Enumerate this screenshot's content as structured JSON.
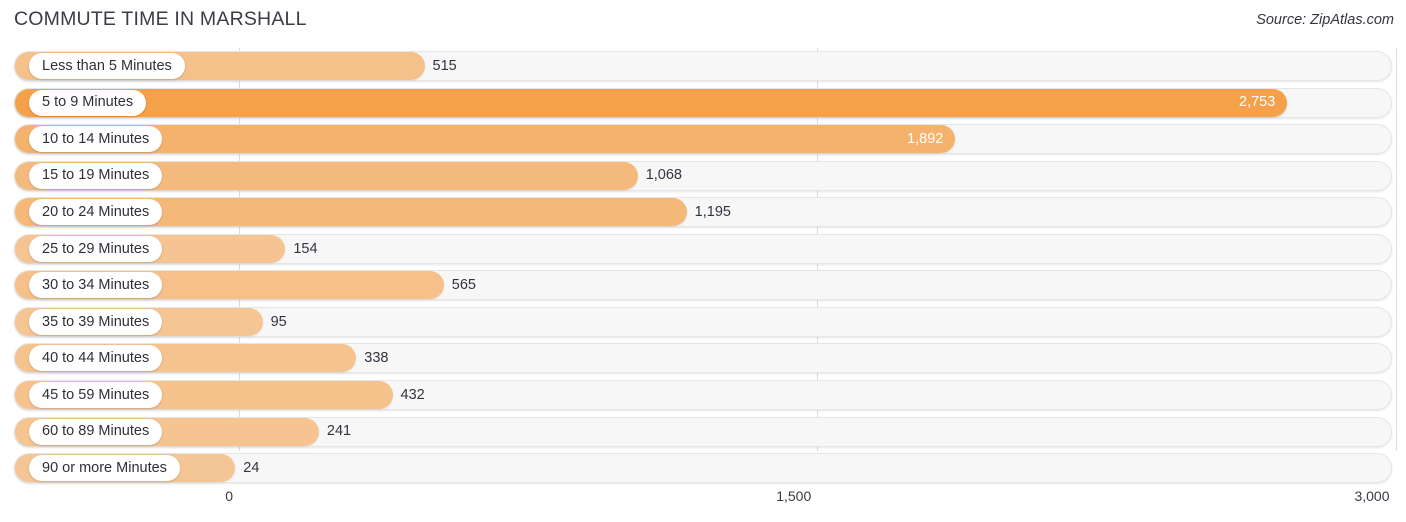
{
  "header": {
    "title": "COMMUTE TIME IN MARSHALL",
    "source": "Source: ZipAtlas.com"
  },
  "colors": {
    "bar": "#f4a14a",
    "track": "#f7f7f7",
    "track_border": "#e6e6e6",
    "gridline": "#dcdcdc",
    "label_text": "#2f2f39",
    "value_text_outside": "#333340",
    "value_text_inside": "#ffffff",
    "title_text": "#3c3c46"
  },
  "chart_data": {
    "type": "bar",
    "orientation": "horizontal",
    "title": "COMMUTE TIME IN MARSHALL",
    "xlabel": "",
    "ylabel": "",
    "xlim": [
      0,
      3000
    ],
    "grid": true,
    "legend": "none",
    "axis_ticks": [
      "0",
      "1,500",
      "3,000"
    ],
    "axis_tick_values": [
      0,
      1500,
      3000
    ],
    "categories": [
      "Less than 5 Minutes",
      "5 to 9 Minutes",
      "10 to 14 Minutes",
      "15 to 19 Minutes",
      "20 to 24 Minutes",
      "25 to 29 Minutes",
      "30 to 34 Minutes",
      "35 to 39 Minutes",
      "40 to 44 Minutes",
      "45 to 59 Minutes",
      "60 to 89 Minutes",
      "90 or more Minutes"
    ],
    "values": [
      515,
      2753,
      1892,
      1068,
      1195,
      154,
      565,
      95,
      338,
      432,
      241,
      24
    ],
    "value_labels": [
      "515",
      "2,753",
      "1,892",
      "1,068",
      "1,195",
      "154",
      "565",
      "95",
      "338",
      "432",
      "241",
      "24"
    ]
  },
  "rows": [
    {
      "label": "Less than 5 Minutes",
      "value": 515,
      "value_label": "515",
      "inside": false,
      "opacity": 0.62
    },
    {
      "label": "5 to 9 Minutes",
      "value": 2753,
      "value_label": "2,753",
      "inside": true,
      "opacity": 1.0
    },
    {
      "label": "10 to 14 Minutes",
      "value": 1892,
      "value_label": "1,892",
      "inside": true,
      "opacity": 0.8
    },
    {
      "label": "15 to 19 Minutes",
      "value": 1068,
      "value_label": "1,068",
      "inside": false,
      "opacity": 0.7
    },
    {
      "label": "20 to 24 Minutes",
      "value": 1195,
      "value_label": "1,195",
      "inside": false,
      "opacity": 0.72
    },
    {
      "label": "25 to 29 Minutes",
      "value": 154,
      "value_label": "154",
      "inside": false,
      "opacity": 0.58
    },
    {
      "label": "30 to 34 Minutes",
      "value": 565,
      "value_label": "565",
      "inside": false,
      "opacity": 0.63
    },
    {
      "label": "35 to 39 Minutes",
      "value": 95,
      "value_label": "95",
      "inside": false,
      "opacity": 0.57
    },
    {
      "label": "40 to 44 Minutes",
      "value": 338,
      "value_label": "338",
      "inside": false,
      "opacity": 0.6
    },
    {
      "label": "45 to 59 Minutes",
      "value": 432,
      "value_label": "432",
      "inside": false,
      "opacity": 0.61
    },
    {
      "label": "60 to 89 Minutes",
      "value": 241,
      "value_label": "241",
      "inside": false,
      "opacity": 0.59
    },
    {
      "label": "90 or more Minutes",
      "value": 24,
      "value_label": "24",
      "inside": false,
      "opacity": 0.56
    }
  ],
  "axis": {
    "ticks": [
      {
        "label": "0",
        "value": 0
      },
      {
        "label": "1,500",
        "value": 1500
      },
      {
        "label": "3,000",
        "value": 3000
      }
    ]
  }
}
